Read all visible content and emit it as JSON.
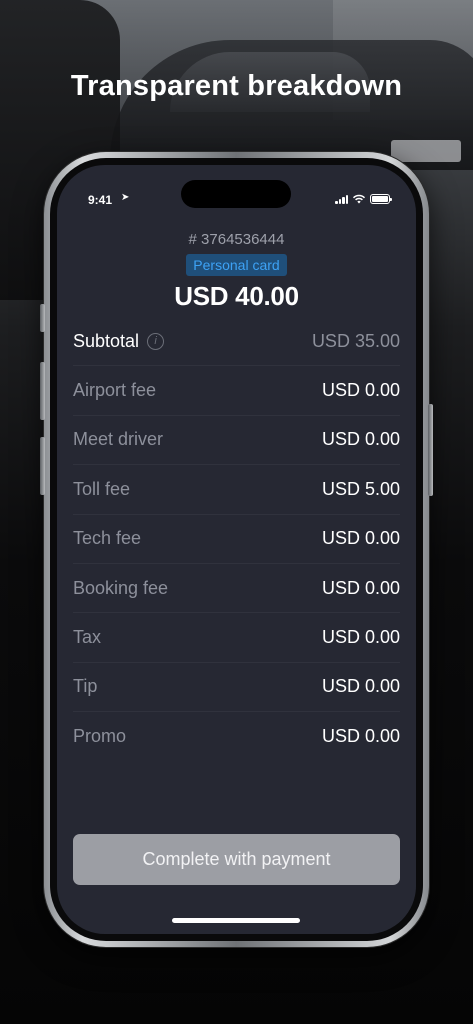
{
  "headline": "Transparent breakdown",
  "status": {
    "time": "9:41"
  },
  "order": {
    "id": "# 3764536444",
    "payment_badge": "Personal card",
    "total": "USD 40.00"
  },
  "breakdown": [
    {
      "label": "Subtotal",
      "value": "USD 35.00"
    },
    {
      "label": "Airport fee",
      "value": "USD 0.00"
    },
    {
      "label": "Meet driver",
      "value": "USD 0.00"
    },
    {
      "label": "Toll fee",
      "value": "USD 5.00"
    },
    {
      "label": "Tech fee",
      "value": "USD 0.00"
    },
    {
      "label": "Booking fee",
      "value": "USD 0.00"
    },
    {
      "label": "Tax",
      "value": "USD 0.00"
    },
    {
      "label": "Tip",
      "value": "USD 0.00"
    },
    {
      "label": "Promo",
      "value": "USD 0.00"
    }
  ],
  "action": {
    "label": "Complete with payment"
  },
  "colors": {
    "screen_bg": "#262833",
    "badge_bg": "#1f4f7a",
    "badge_text": "#3da2f5",
    "button_bg": "#9c9ea4"
  }
}
